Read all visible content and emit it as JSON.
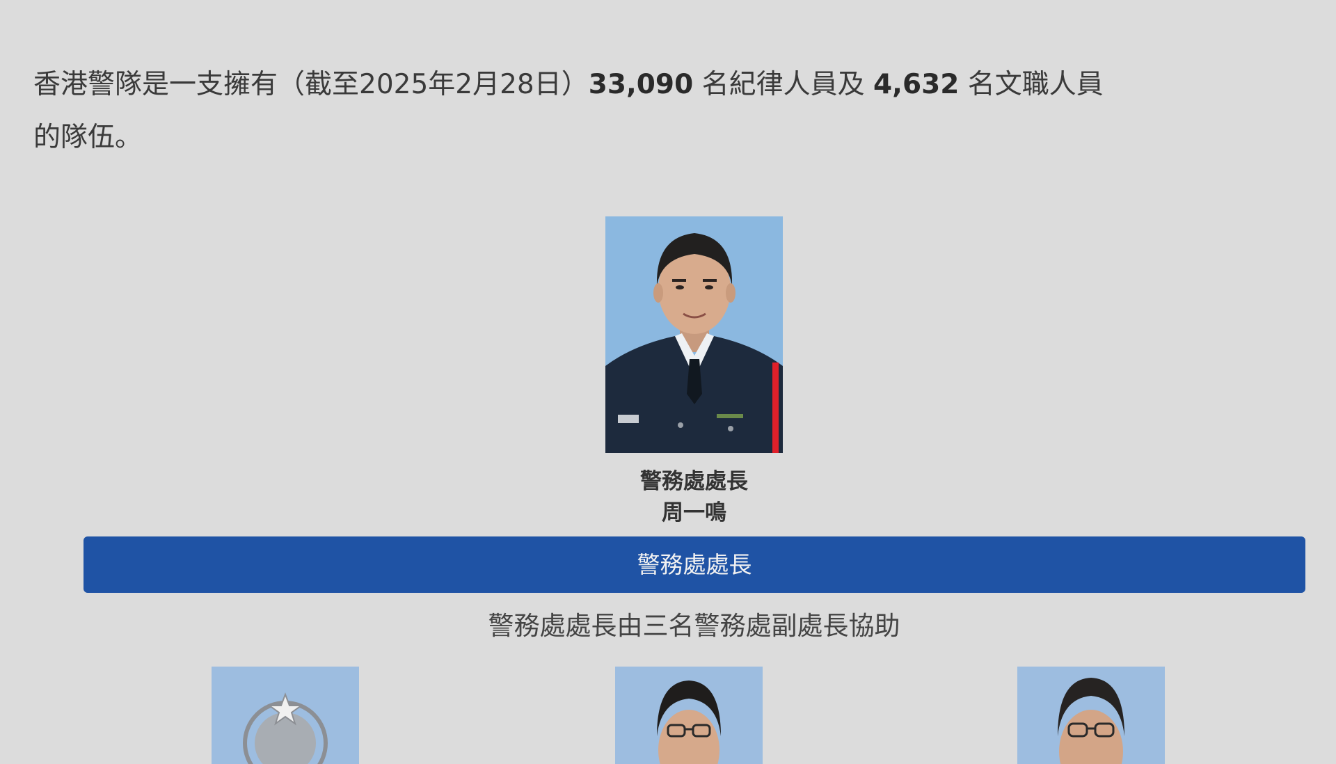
{
  "intro": {
    "text_1": "香港警隊是一支擁有（截至2025年2月28日）",
    "disciplined_count": "33,090",
    "text_2": " 名紀律人員及 ",
    "civilian_count": "4,632",
    "text_3": " 名文職人員的隊伍。"
  },
  "chief": {
    "title": "警務處處長",
    "name": "周一鳴"
  },
  "section": {
    "header": "警務處處長",
    "caption": "警務處處長由三名警務處副處長協助"
  },
  "colors": {
    "page_background": "#dcdcdc",
    "header_bar": "#1f53a5",
    "photo_background": "#8bb8e0",
    "uniform_red_stripe": "#e0202a"
  },
  "icons": {
    "deputy_1_photo": "police-crest-icon"
  }
}
